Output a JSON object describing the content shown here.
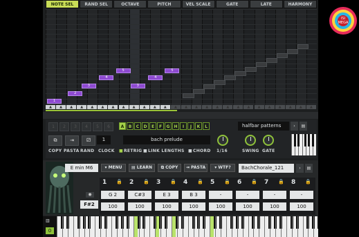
{
  "header": {
    "tabs": [
      "NOTE SEL",
      "RAND SEL",
      "OCTAVE",
      "PITCH",
      "VEL SCALE",
      "GATE",
      "LATE",
      "HARMONY"
    ],
    "active_tab": "NOTE SEL"
  },
  "grid": {
    "notes": [
      {
        "step": 1,
        "label": "1"
      },
      {
        "step": 2,
        "label": "2"
      },
      {
        "step": 3,
        "label": "3"
      },
      {
        "step": 4,
        "label": "4"
      },
      {
        "step": 5,
        "label": "5"
      },
      {
        "step": 6,
        "label": "3"
      },
      {
        "step": 7,
        "label": "4"
      },
      {
        "step": 8,
        "label": "5"
      }
    ],
    "marker_glyph": "▲"
  },
  "controls": {
    "step_boxes": [
      "1",
      "2",
      "3",
      "4",
      "5",
      "6"
    ],
    "copy_label": "COPY",
    "paste_label": "PASTA",
    "rand_label": "RAND",
    "clock_label": "CLOCK",
    "clock_value": "1",
    "letters": [
      "A",
      "B",
      "C",
      "D",
      "E",
      "F",
      "G",
      "H",
      "I",
      "J",
      "K",
      "L"
    ],
    "active_letter": "A",
    "pattern_name": "bach prelude",
    "retrig_label": "RETRIG",
    "link_lengths_label": "LINK LENGTHS",
    "chord_label": "CHORD",
    "rate_label": "1/16",
    "preset_dropdown": "halfbar patterns",
    "swing_label": "SWING",
    "gate_label": "GATE"
  },
  "lower": {
    "chord_name": "E min M6",
    "menu_label": "MENU",
    "learn_label": "LEARN",
    "copy_label": "COPY",
    "paste_label": "PASTA",
    "wtf_label": "WTF?",
    "preset_name": "BachChorale_121",
    "root_key": "F#2",
    "slots": [
      {
        "num": "1",
        "note": "G 2",
        "vel": "100"
      },
      {
        "num": "2",
        "note": "C#3",
        "vel": "100"
      },
      {
        "num": "3",
        "note": "E 3",
        "vel": "100"
      },
      {
        "num": "4",
        "note": "B 3",
        "vel": "100"
      },
      {
        "num": "5",
        "note": "-",
        "vel": "100"
      },
      {
        "num": "6",
        "note": "-",
        "vel": "100"
      },
      {
        "num": "7",
        "note": "-",
        "vel": "100"
      },
      {
        "num": "8",
        "note": "-",
        "vel": "100"
      }
    ]
  },
  "keyboard": {
    "octave_value": "0"
  },
  "logo": {
    "text": "ISI MEGA"
  },
  "colors": {
    "accent": "#a5d24a",
    "note": "#8e4ad0"
  }
}
